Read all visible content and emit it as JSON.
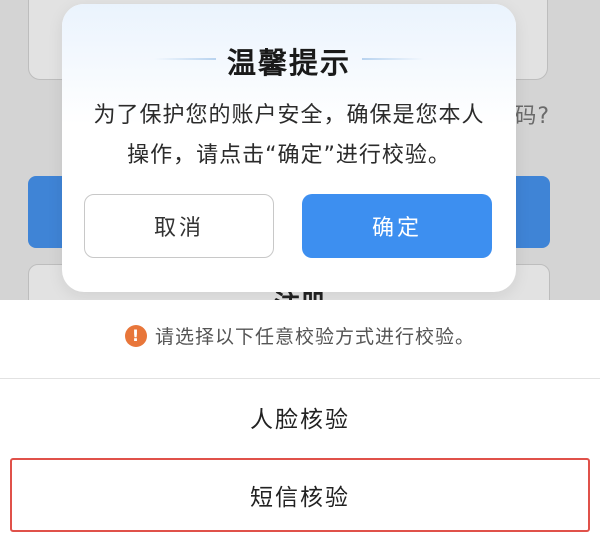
{
  "background": {
    "forgot_fragment": "码?",
    "register_label": "注册"
  },
  "dialog": {
    "title": "温馨提示",
    "message_line1": "为了保护您的账户安全，确保是您本人",
    "message_line2": "操作，请点击“确定”进行校验。",
    "cancel_label": "取消",
    "confirm_label": "确定"
  },
  "sheet": {
    "notice_icon": "!",
    "notice_text": "请选择以下任意校验方式进行校验。",
    "options": [
      {
        "label": "人脸核验"
      },
      {
        "label": "短信核验"
      }
    ]
  },
  "colors": {
    "accent": "#3d8ff0",
    "warning": "#e8763a",
    "highlight_border": "#e0514a"
  }
}
